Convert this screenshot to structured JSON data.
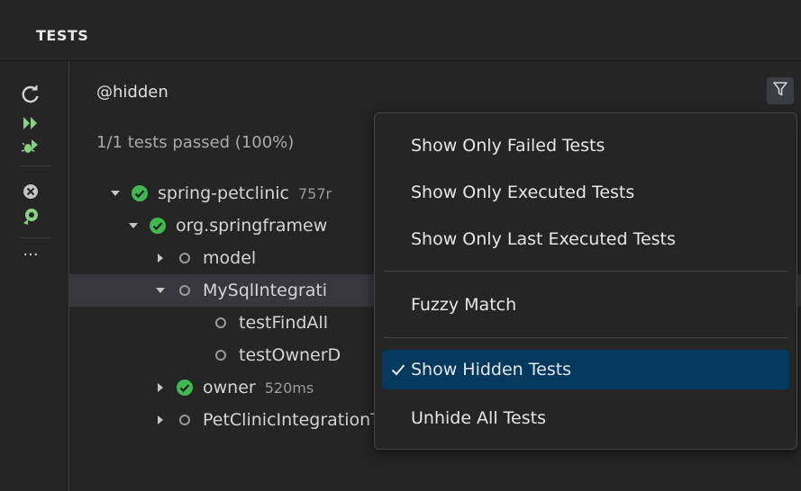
{
  "panel": {
    "title": "TESTS"
  },
  "toolbar": {
    "refresh_icon": "refresh-icon",
    "run_all_icon": "run-all-icon",
    "debug_all_icon": "debug-all-icon",
    "clear_results_icon": "clear-results-icon",
    "coverage_icon": "coverage-icon",
    "more_label": "···"
  },
  "filter": {
    "value": "@hidden",
    "filter_icon": "filter-icon"
  },
  "summary": "1/1 tests passed (100%)",
  "tree": [
    {
      "label": "spring-petclinic",
      "duration": "757r",
      "status": "passed",
      "expanded": true
    },
    {
      "label": "org.springframew",
      "duration": "",
      "status": "passed",
      "expanded": true
    },
    {
      "label": "model",
      "duration": "",
      "status": "not-run",
      "expanded": false
    },
    {
      "label": "MySqlIntegrati",
      "duration": "",
      "status": "not-run",
      "expanded": true
    },
    {
      "label": "testFindAll",
      "duration": "",
      "status": "not-run"
    },
    {
      "label": "testOwnerD",
      "duration": "",
      "status": "not-run"
    },
    {
      "label": "owner",
      "duration": "520ms",
      "status": "passed",
      "expanded": false
    },
    {
      "label": "PetClinicIntegrationTests",
      "duration": "",
      "status": "not-run",
      "expanded": false
    }
  ],
  "menu": {
    "items": [
      {
        "label": "Show Only Failed Tests",
        "checked": false
      },
      {
        "label": "Show Only Executed Tests",
        "checked": false
      },
      {
        "label": "Show Only Last Executed Tests",
        "checked": false
      },
      {
        "label": "Fuzzy Match",
        "checked": false
      },
      {
        "label": "Show Hidden Tests",
        "checked": true
      },
      {
        "label": "Unhide All Tests",
        "checked": false
      }
    ]
  },
  "colors": {
    "pass": "#3fb950",
    "run": "#89d185",
    "selection": "#04395e"
  }
}
